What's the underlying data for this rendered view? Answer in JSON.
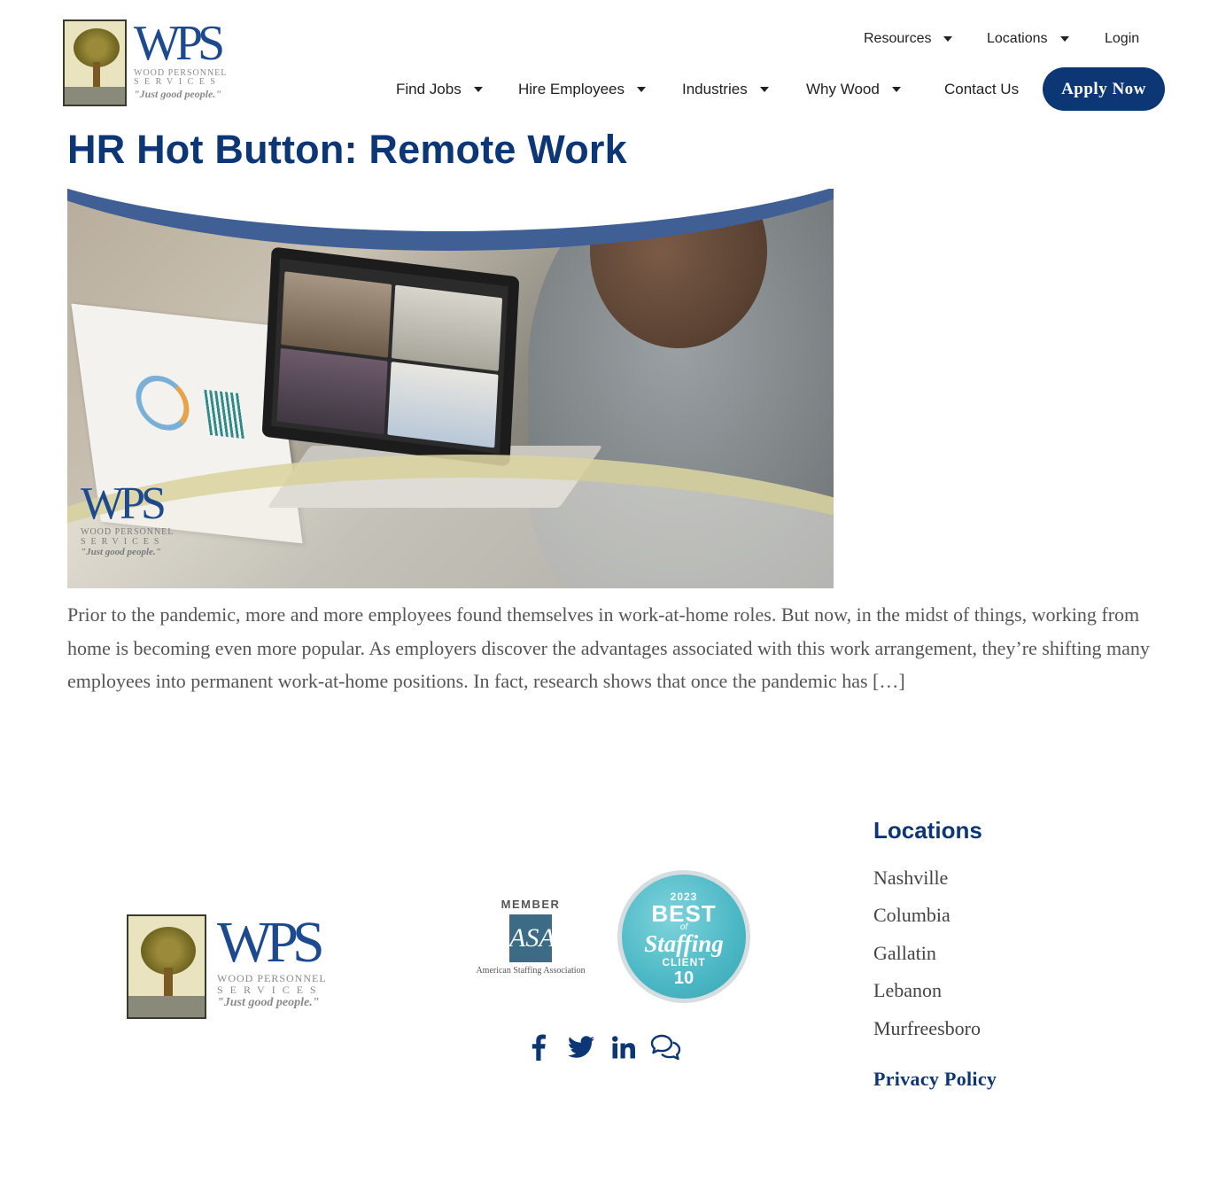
{
  "brand": {
    "logo_letters": "WPS",
    "logo_line1": "WOOD PERSONNEL",
    "logo_line2": "SERVICES",
    "tagline": "\"Just good people.\"",
    "primary_color": "#0d3675"
  },
  "top_nav": {
    "resources": "Resources",
    "locations": "Locations",
    "login": "Login"
  },
  "main_nav": {
    "find_jobs": "Find Jobs",
    "hire_employees": "Hire Employees",
    "industries": "Industries",
    "why_wood": "Why Wood",
    "contact_us": "Contact Us",
    "apply_now": "Apply Now"
  },
  "article": {
    "title": "HR Hot Button: Remote Work",
    "excerpt": "Prior to the pandemic, more and more employees found themselves in work-at-home roles. But now, in the midst of things, working from home is becoming even more popular. As employers discover the advantages associated with this work arrangement, they’re shifting many employees into permanent work-at-home positions. In fact, research shows that once the pandemic has […]"
  },
  "footer": {
    "asa": {
      "member": "MEMBER",
      "mark": "ASA",
      "name": "American Staffing Association"
    },
    "best_of_staffing": {
      "year": "2023",
      "best": "BEST",
      "of": "of",
      "staffing": "Staffing",
      "client": "CLIENT",
      "years": "10"
    },
    "social_icons": [
      "facebook-icon",
      "twitter-icon",
      "linkedin-icon",
      "chat-icon"
    ],
    "locations_heading": "Locations",
    "locations": [
      "Nashville",
      "Columbia",
      "Gallatin",
      "Lebanon",
      "Murfreesboro"
    ],
    "privacy_policy": "Privacy Policy"
  }
}
